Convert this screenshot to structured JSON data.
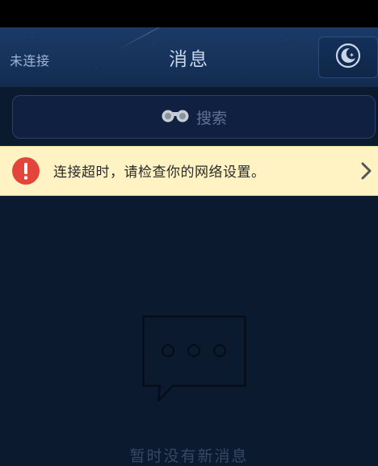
{
  "header": {
    "connection_status": "未连接",
    "title": "消息",
    "night_mode_icon": "moon-icon"
  },
  "search": {
    "icon": "binoculars-icon",
    "label": "搜索"
  },
  "alert": {
    "icon": "exclamation-icon",
    "message": "连接超时，请检查你的网络设置。",
    "arrow_icon": "chevron-right-icon",
    "icon_color": "#e4453a",
    "background": "#fff3c4"
  },
  "empty_state": {
    "icon": "chat-bubble-icon",
    "message": "暂时没有新消息"
  },
  "colors": {
    "background": "#0c1a30",
    "header": "#16325a"
  }
}
